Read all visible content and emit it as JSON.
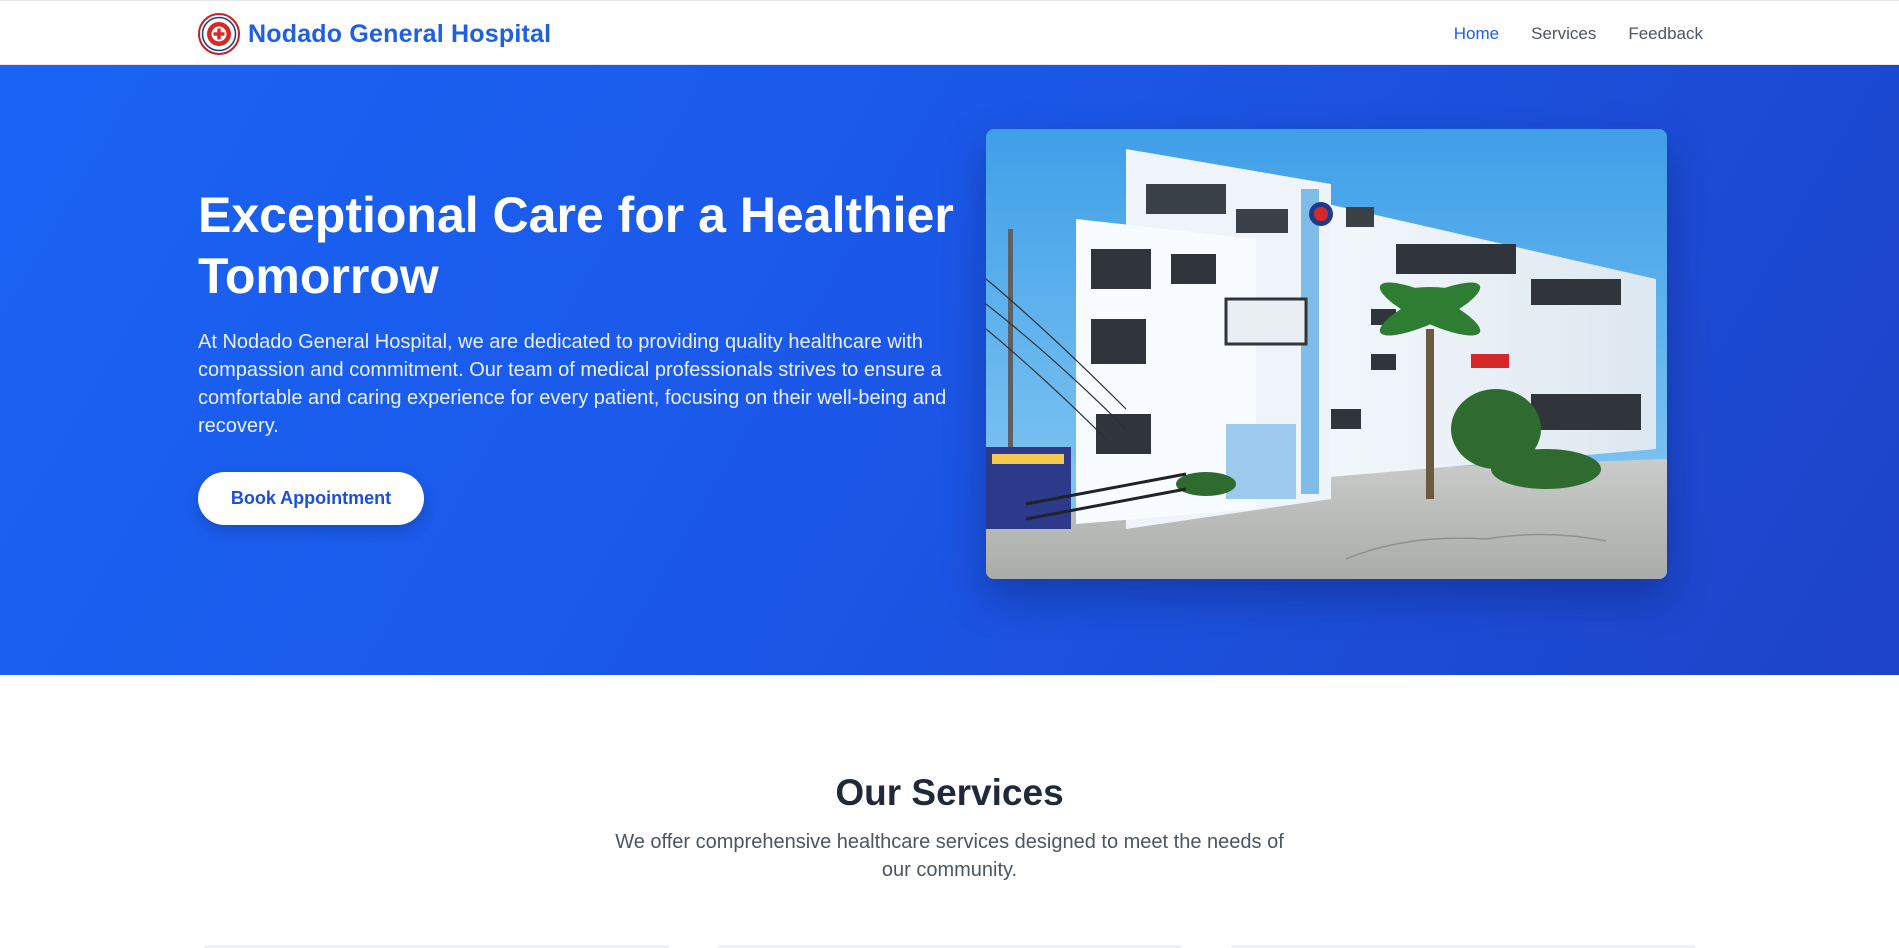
{
  "brand": {
    "name": "Nodado General Hospital",
    "logo_icon": "hospital-seal-logo"
  },
  "nav": {
    "items": [
      {
        "label": "Home",
        "active": true
      },
      {
        "label": "Services",
        "active": false
      },
      {
        "label": "Feedback",
        "active": false
      }
    ]
  },
  "hero": {
    "title": "Exceptional Care for a Healthier Tomorrow",
    "text": "At Nodado General Hospital, we are dedicated to providing quality healthcare with compassion and commitment. Our team of medical professionals strives to ensure a comfortable and caring experience for every patient, focusing on their well-being and recovery.",
    "cta_label": "Book Appointment",
    "image_icon": "hospital-building-photo"
  },
  "services": {
    "title": "Our Services",
    "subtitle": "We offer comprehensive healthcare services designed to meet the needs of our community."
  },
  "colors": {
    "brand_blue": "#1d5fe6",
    "hero_start": "#1a63f4",
    "hero_end": "#1d43c8",
    "text_dark": "#1f2937",
    "text_muted": "#4b5563"
  }
}
